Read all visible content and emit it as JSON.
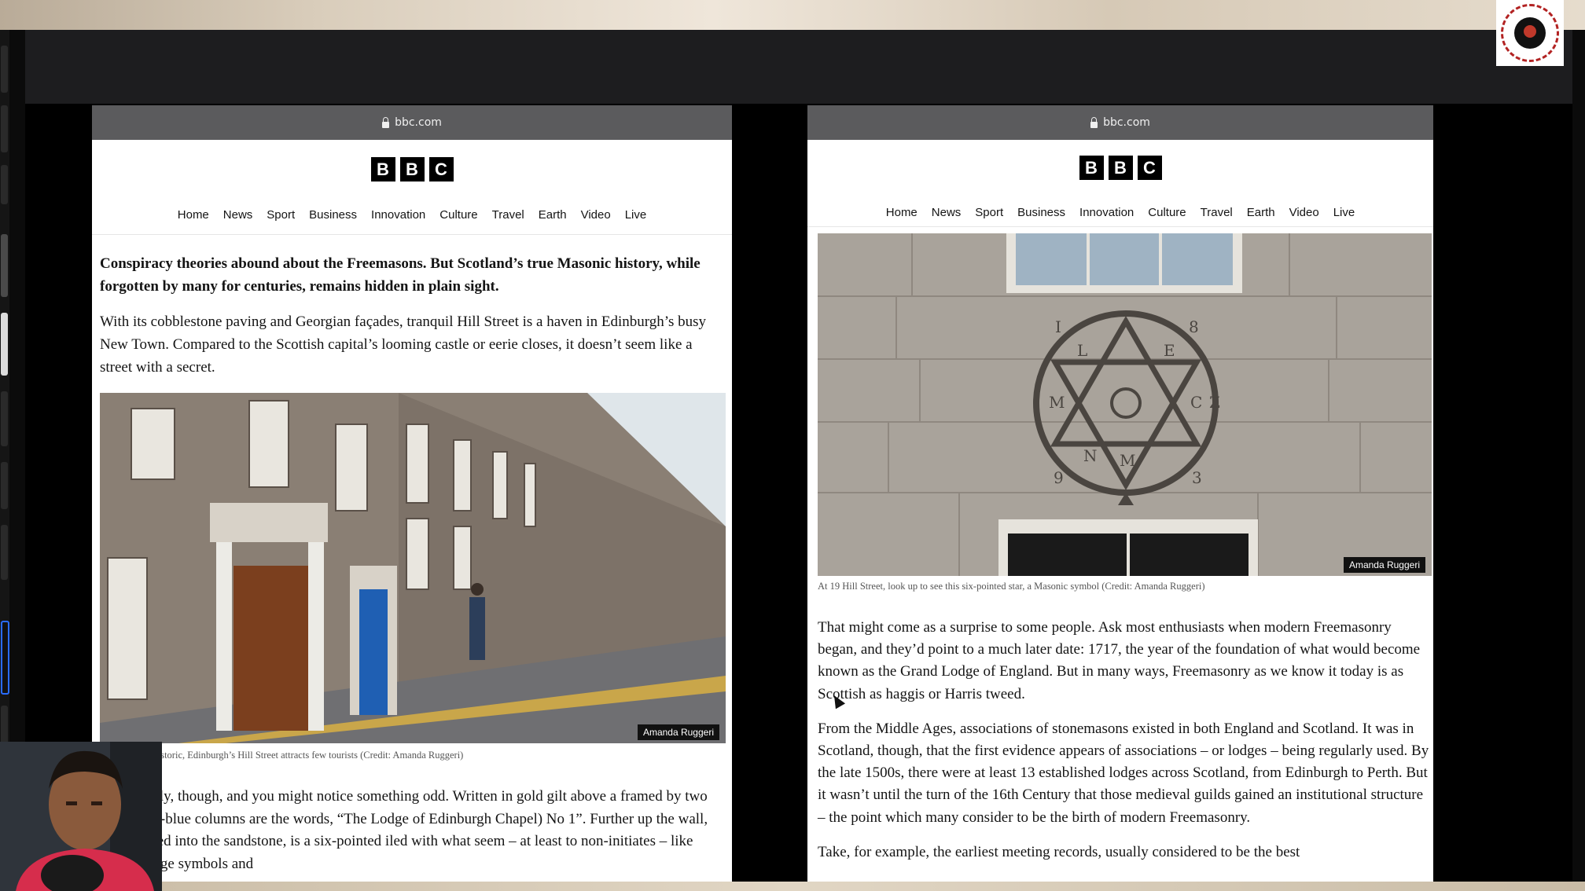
{
  "left_browser": {
    "url": "bbc.com",
    "logo_letters": [
      "B",
      "B",
      "C"
    ],
    "nav": [
      "Home",
      "News",
      "Sport",
      "Business",
      "Innovation",
      "Culture",
      "Travel",
      "Earth",
      "Video",
      "Live"
    ],
    "lead": "Conspiracy theories abound about the Freemasons. But Scotland’s true Masonic history, while forgotten by many for centuries, remains hidden in plain sight.",
    "intro": "With its cobblestone paving and Georgian façades, tranquil Hill Street is a haven in Edinburgh’s busy New Town. Compared to the Scottish capital’s looming castle or eerie closes, it doesn’t seem like a street with a secret.",
    "photo_credit": "Amanda Ruggeri",
    "caption": "uil and historic, Edinburgh’s Hill Street attracts few tourists (Credit: Amanda Ruggeri)",
    "body": "slowly, though, and you might notice something odd. Written in gold gilt above a framed by two baby-blue columns are the words, “The Lodge of Edinburgh Chapel) No 1”. Further up the wall, carved into the sandstone, is a six-pointed iled with what seem – at least to non-initiates – like strange symbols and"
  },
  "right_browser": {
    "url": "bbc.com",
    "logo_letters": [
      "B",
      "B",
      "C"
    ],
    "nav": [
      "Home",
      "News",
      "Sport",
      "Business",
      "Innovation",
      "Culture",
      "Travel",
      "Earth",
      "Video",
      "Live"
    ],
    "photo_credit": "Amanda Ruggeri",
    "star_letters": [
      "I",
      "8",
      "L",
      "E",
      "M",
      "C",
      "Z",
      "N",
      "M",
      "9",
      "3"
    ],
    "caption": "At 19 Hill Street, look up to see this six-pointed star, a Masonic symbol (Credit: Amanda Ruggeri)",
    "para1": "That might come as a surprise to some people. Ask most enthusiasts when modern Freemasonry began, and they’d point to a much later date: 1717, the year of the foundation of what would become known as the Grand Lodge of England. But in many ways, Freemasonry as we know it today is as Scottish as haggis or Harris tweed.",
    "para2": "From the Middle Ages, associations of stonemasons existed in both England and Scotland. It was in Scotland, though, that the first evidence appears of associations – or lodges – being regularly used. By the late 1500s, there were at least 13 established lodges across Scotland, from Edinburgh to Perth. But it wasn’t until the turn of the 16th Century that those medieval guilds gained an institutional structure – the point which many consider to be the birth of modern Freemasonry.",
    "para3": "Take, for example, the earliest meeting records, usually considered to be the best"
  },
  "colors": {
    "url_bar": "#5b5b5d",
    "window_bar": "#1d1d1f",
    "credit_tag": "#111111",
    "dock_active": "#2a6cff",
    "logo_ring": "#b22222"
  },
  "icons": [
    "lock-icon",
    "channel-logo",
    "dock-icons",
    "mouse-cursor"
  ]
}
